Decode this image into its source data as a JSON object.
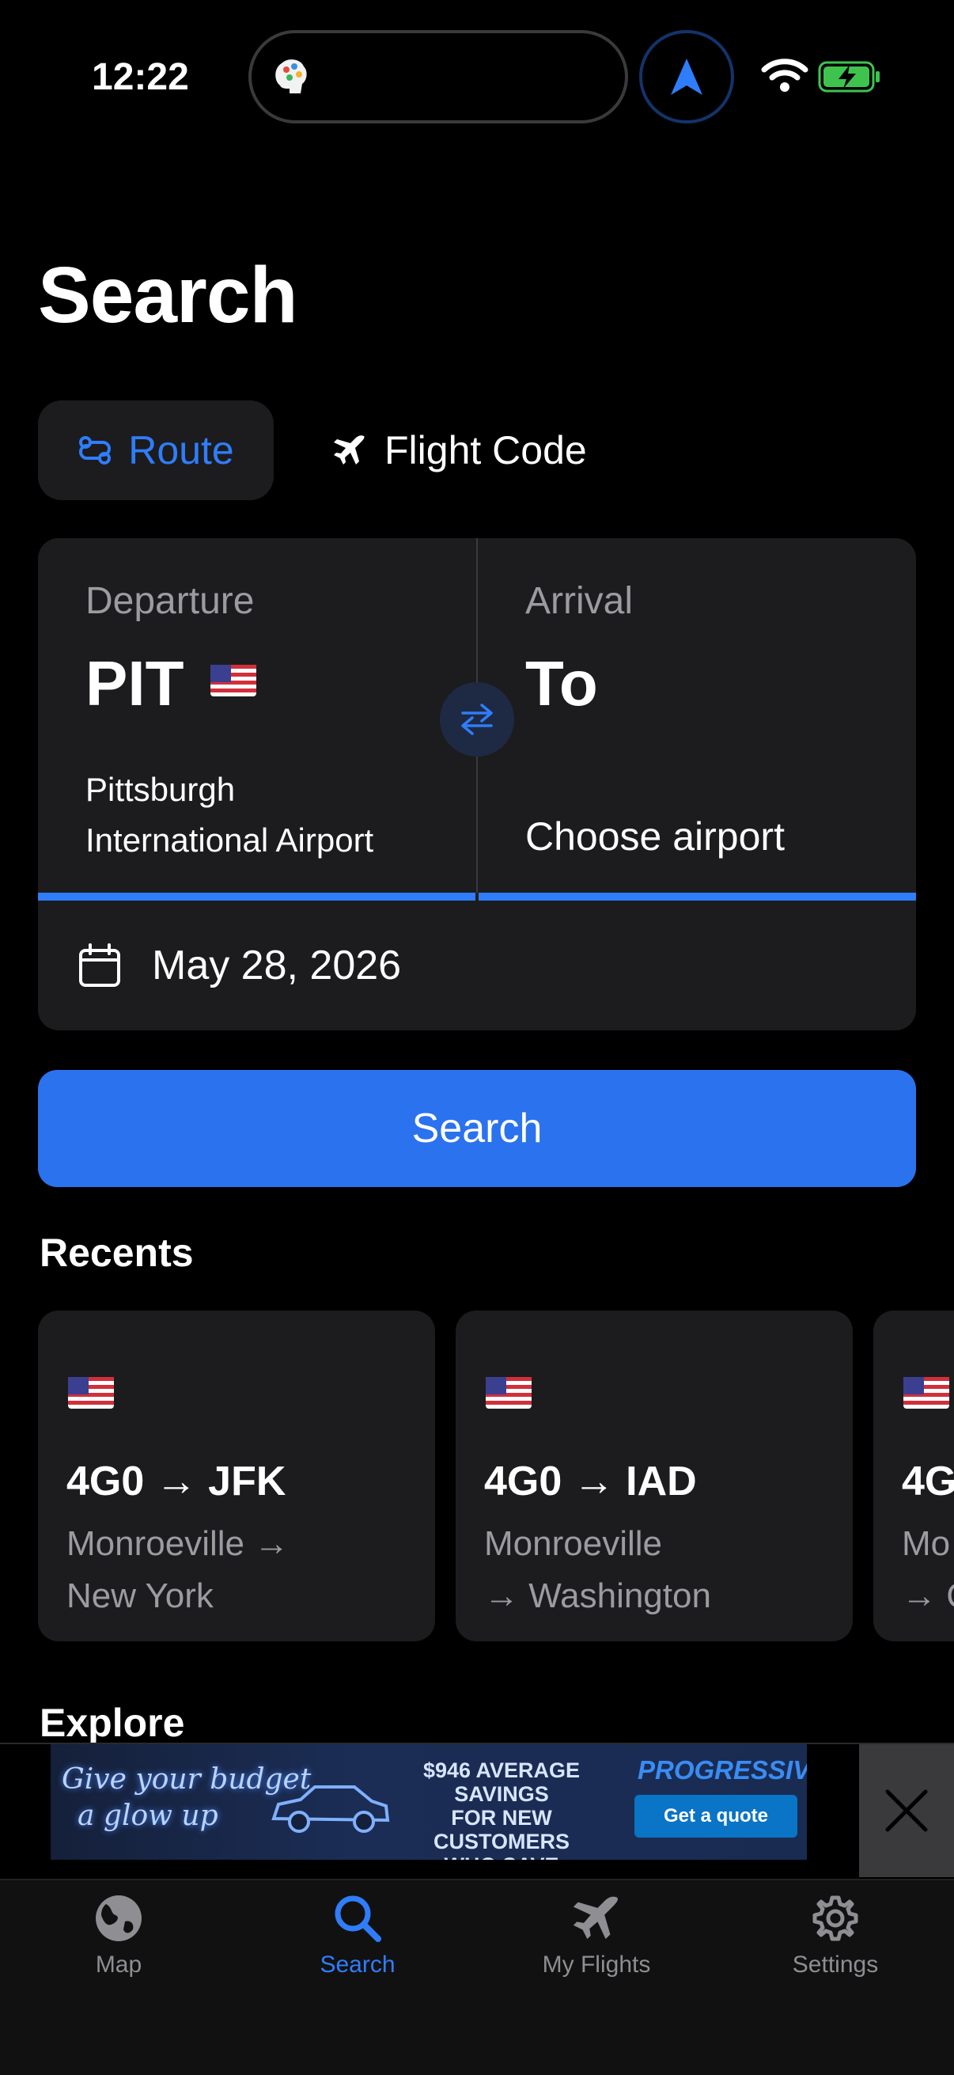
{
  "status_bar": {
    "time": "12:22"
  },
  "title": "Search",
  "tabs": {
    "route": "Route",
    "flight_code": "Flight Code"
  },
  "route_card": {
    "departure": {
      "label": "Departure",
      "code": "PIT",
      "name_line1": "Pittsburgh",
      "name_line2": "International Airport"
    },
    "arrival": {
      "label": "Arrival",
      "code": "To",
      "placeholder": "Choose airport"
    },
    "date": "May 28, 2026"
  },
  "search_button": "Search",
  "recents": {
    "title": "Recents",
    "items": [
      {
        "route": "4G0 → JFK",
        "city_line1": "Monroeville →",
        "city_line2": "New York"
      },
      {
        "route": "4G0 → IAD",
        "city_line1": "Monroeville",
        "city_line2": "→ Washington"
      },
      {
        "route": "4G",
        "city_line1": "Mo",
        "city_line2": "→ C"
      }
    ]
  },
  "explore": {
    "title": "Explore"
  },
  "ad": {
    "headline_line1": "Give your budget",
    "headline_line2": "a glow up",
    "offer_line1": "$946 AVERAGE SAVINGS",
    "offer_line2": "FOR NEW CUSTOMERS",
    "offer_line3": "WHO SAVE",
    "brand": "PROGRESSIVE",
    "cta": "Get a quote"
  },
  "tabbar": {
    "map": "Map",
    "search": "Search",
    "my_flights": "My Flights",
    "settings": "Settings"
  },
  "colors": {
    "accent": "#2f7dfa",
    "card": "#1c1c1e",
    "muted": "#9b9ba0"
  }
}
